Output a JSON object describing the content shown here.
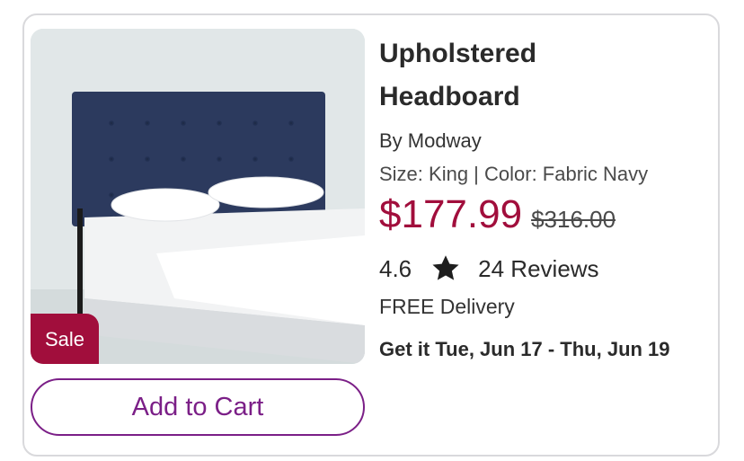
{
  "product": {
    "title_line1": "Upholstered",
    "title_line2": "Headboard",
    "brand": "By Modway",
    "variant": "Size: King | Color: Fabric Navy",
    "price": "$177.99",
    "was_price": "$316.00",
    "rating": "4.6",
    "rating_icon": "star-icon",
    "reviews": "24 Reviews",
    "delivery": "FREE Delivery",
    "eta": "Get it Tue, Jun 17 - Thu, Jun 19",
    "badge": "Sale",
    "image_alt": "navy tufted upholstered headboard on bed"
  },
  "actions": {
    "add_to_cart": "Add to Cart"
  },
  "colors": {
    "price": "#a10e3c",
    "badge_bg": "#a10e3c",
    "button_accent": "#7b1f87",
    "headboard": "#2c3a5e"
  }
}
